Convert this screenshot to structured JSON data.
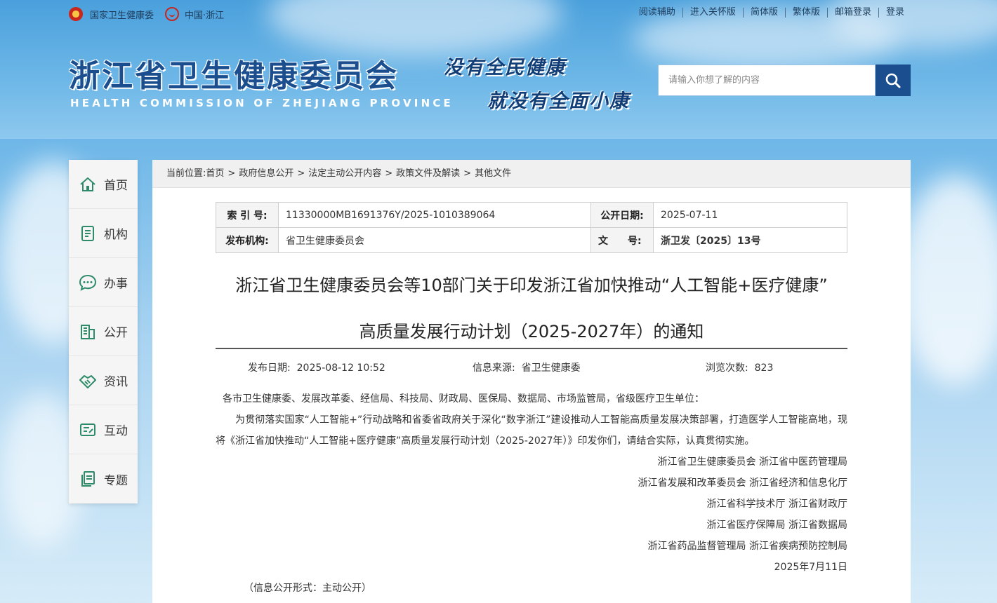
{
  "top_links_left": {
    "nhc": "国家卫生健康委",
    "zj": "中国·浙江"
  },
  "top_links_right": [
    "阅读辅助",
    "进入关怀版",
    "简体版",
    "繁体版",
    "邮箱登录",
    "登录"
  ],
  "site": {
    "title": "浙江省卫生健康委员会",
    "subtitle": "HEALTH COMMISSION OF ZHEJIANG PROVINCE",
    "slogan_line1": "没有全民健康",
    "slogan_line2": "就没有全面小康"
  },
  "search": {
    "placeholder": "请输入你想了解的内容"
  },
  "sidebar": {
    "items": [
      {
        "label": "首页",
        "icon": "home-icon"
      },
      {
        "label": "机构",
        "icon": "document-icon"
      },
      {
        "label": "办事",
        "icon": "chat-icon"
      },
      {
        "label": "公开",
        "icon": "building-icon"
      },
      {
        "label": "资讯",
        "icon": "handshake-icon"
      },
      {
        "label": "互动",
        "icon": "feedback-icon"
      },
      {
        "label": "专题",
        "icon": "files-icon"
      }
    ]
  },
  "breadcrumb": {
    "prefix": "当前位置:",
    "items": [
      "首页",
      "政府信息公开",
      "法定主动公开内容",
      "政策文件及解读",
      "其他文件"
    ]
  },
  "meta": {
    "index_label": "索 引 号:",
    "index_value": "11330000MB1691376Y/2025-1010389064",
    "date_label": "公开日期:",
    "date_value": "2025-07-11",
    "org_label": "发布机构:",
    "org_value": "省卫生健康委员会",
    "docno_label": "文　　号:",
    "docno_value": "浙卫发〔2025〕13号"
  },
  "article": {
    "title_line1": "浙江省卫生健康委员会等10部门关于印发浙江省加快推动“人工智能+医疗健康”",
    "title_line2": "高质量发展行动计划（2025-2027年）的通知",
    "publish_label": "发布日期:",
    "publish_value": "2025-08-12 10:52",
    "source_label": "信息来源:",
    "source_value": "省卫生健康委",
    "views_label": "浏览次数:",
    "views_value": "823",
    "salutation": "各市卫生健康委、发展改革委、经信局、科技局、财政局、医保局、数据局、市场监管局，省级医疗卫生单位：",
    "paragraph": "为贯彻落实国家“人工智能+”行动战略和省委省政府关于深化“数字浙江”建设推动人工智能高质量发展决策部署，打造医学人工智能高地，现将《浙江省加快推动“人工智能+医疗健康”高质量发展行动计划（2025-2027年）》印发你们，请结合实际，认真贯彻实施。",
    "signatures": [
      "浙江省卫生健康委员会 浙江省中医药管理局",
      "浙江省发展和改革委员会 浙江省经济和信息化厅",
      "浙江省科学技术厅 浙江省财政厅",
      "浙江省医疗保障局 浙江省数据局",
      "浙江省药品监督管理局 浙江省疾病预防控制局"
    ],
    "sign_date": "2025年7月11日",
    "footer_partial": "（信息公开形式：主动公开）"
  }
}
